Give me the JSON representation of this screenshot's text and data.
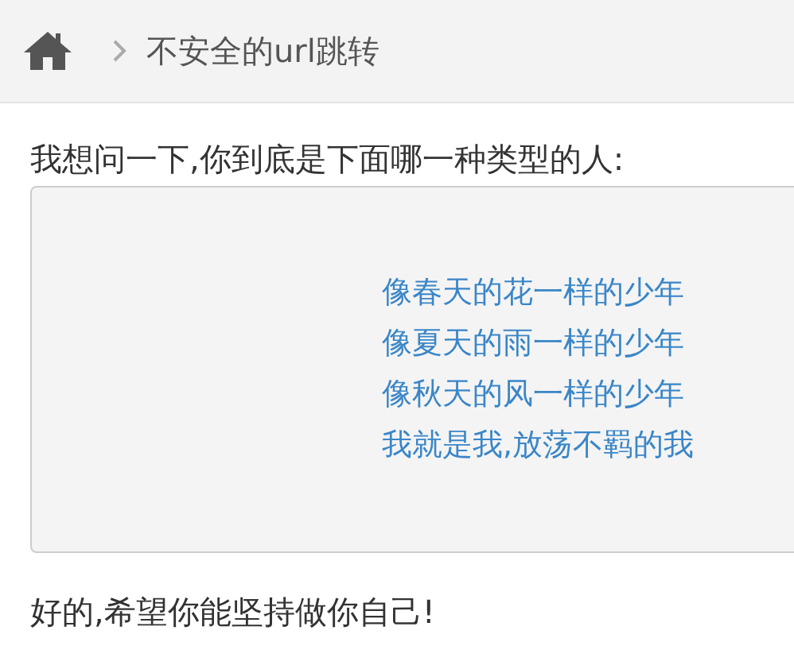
{
  "breadcrumb": {
    "current": "不安全的url跳转"
  },
  "question": "我想问一下,你到底是下面哪一种类型的人:",
  "options": [
    "像春天的花一样的少年",
    "像夏天的雨一样的少年",
    "像秋天的风一样的少年",
    "我就是我,放荡不羁的我"
  ],
  "reply": "好的,希望你能坚持做你自己!"
}
